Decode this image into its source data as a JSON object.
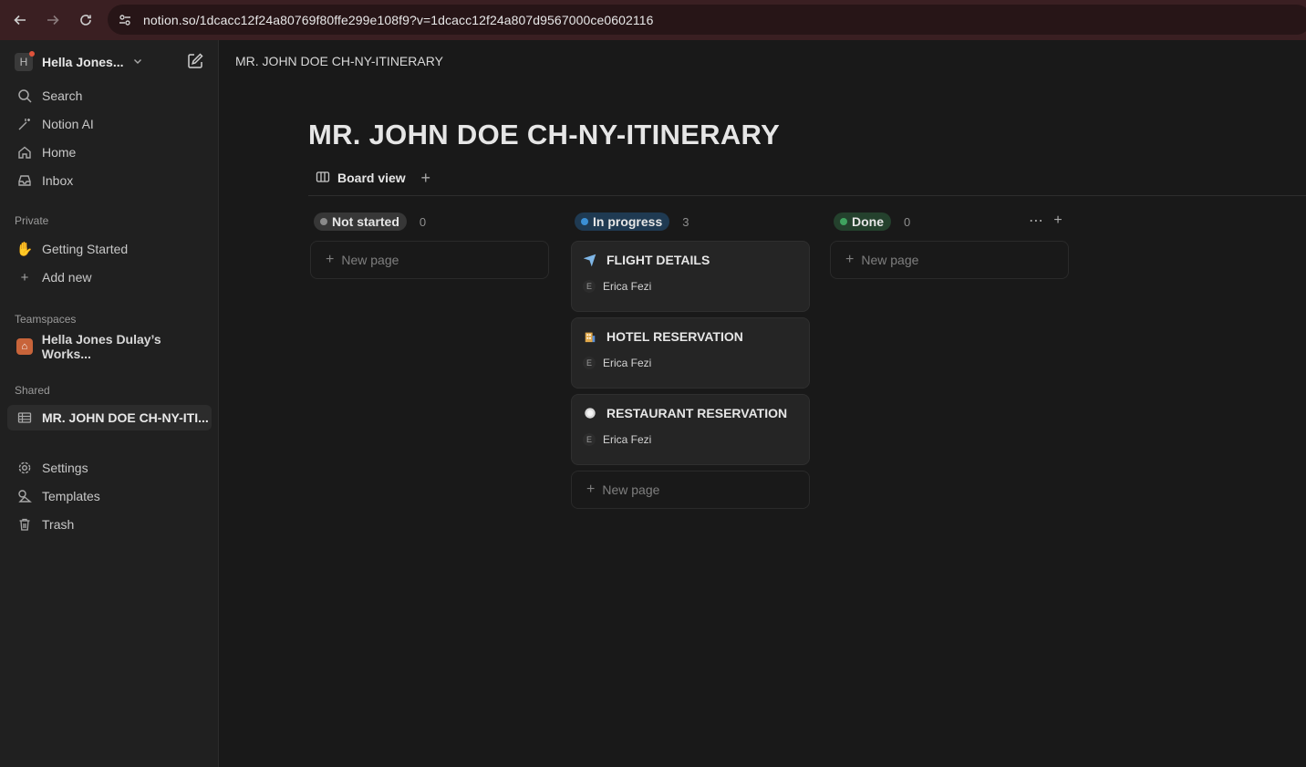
{
  "browser": {
    "url": "notion.so/1dcacc12f24a80769f80ffe299e108f9?v=1dcacc12f24a807d9567000ce0602116"
  },
  "sidebar": {
    "workspace_initial": "H",
    "workspace_name": "Hella Jones...",
    "nav": [
      {
        "label": "Search",
        "icon": "search-icon"
      },
      {
        "label": "Notion AI",
        "icon": "notion-ai-icon"
      },
      {
        "label": "Home",
        "icon": "home-icon"
      },
      {
        "label": "Inbox",
        "icon": "inbox-icon"
      }
    ],
    "private_heading": "Private",
    "private_items": [
      {
        "label": "Getting Started",
        "icon": "waving-hand-icon"
      },
      {
        "label": "Add new",
        "icon": "plus-icon"
      }
    ],
    "teamspaces_heading": "Teamspaces",
    "teamspace": {
      "label": "Hella Jones Dulay’s Works...",
      "icon": "house-icon"
    },
    "shared_heading": "Shared",
    "shared_item": {
      "label": "MR. JOHN DOE CH-NY-ITI...",
      "icon": "table-icon"
    },
    "bottom": [
      {
        "label": "Settings",
        "icon": "gear-icon"
      },
      {
        "label": "Templates",
        "icon": "templates-icon"
      },
      {
        "label": "Trash",
        "icon": "trash-icon"
      }
    ]
  },
  "topbar": {
    "title": "MR. JOHN DOE CH-NY-ITINERARY"
  },
  "page": {
    "title": "MR. JOHN DOE CH-NY-ITINERARY",
    "view_label": "Board view"
  },
  "board": {
    "columns": [
      {
        "status": "Not started",
        "count": "0",
        "dot_color": "#8a8a8a",
        "pill_bg": "#373737",
        "new_page_label": "New page",
        "cards": []
      },
      {
        "status": "In progress",
        "count": "3",
        "dot_color": "#3b8fd4",
        "pill_bg": "#1f3a52",
        "new_page_label": "New page",
        "cards": [
          {
            "title": "FLIGHT DETAILS",
            "icon": "airplane-icon",
            "person_initial": "E",
            "person": "Erica Fezi"
          },
          {
            "title": "HOTEL RESERVATION",
            "icon": "hotel-icon",
            "person_initial": "E",
            "person": "Erica Fezi"
          },
          {
            "title": "RESTAURANT RESERVATION",
            "icon": "plate-icon",
            "person_initial": "E",
            "person": "Erica Fezi"
          }
        ]
      },
      {
        "status": "Done",
        "count": "0",
        "dot_color": "#3fa35f",
        "pill_bg": "#24412d",
        "new_page_label": "New page",
        "cards": []
      }
    ]
  }
}
